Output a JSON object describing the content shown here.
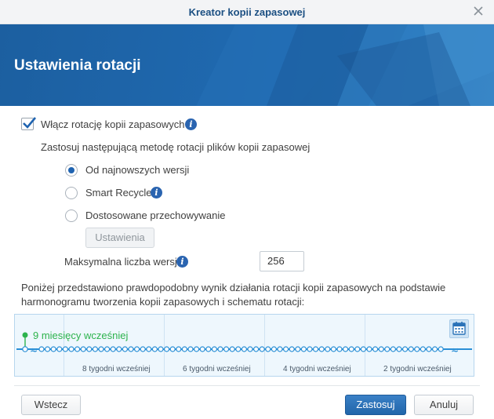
{
  "window": {
    "title": "Kreator kopii zapasowej"
  },
  "banner": {
    "heading": "Ustawienia rotacji"
  },
  "rotation": {
    "enable_label": "Włącz rotację kopii zapasowych",
    "enabled": true,
    "method_label": "Zastosuj następującą metodę rotacji plików kopii zapasowej",
    "options": [
      {
        "label": "Od najnowszych wersji",
        "selected": true
      },
      {
        "label": "Smart Recycle",
        "selected": false
      },
      {
        "label": "Dostosowane przechowywanie",
        "selected": false
      }
    ],
    "settings_button": "Ustawienia",
    "max_versions_label": "Maksymalna liczba wersji",
    "max_versions_value": "256"
  },
  "preview": {
    "description_line1": "Poniżej przedstawiono prawdopodobny wynik działania rotacji kopii zapasowych na podstawie",
    "description_line2": "harmonogramu tworzenia kopii zapasowych i schematu rotacji:",
    "oldest_label": "9 miesięcy wcześniej",
    "tick_labels": [
      "8 tygodni wcześniej",
      "6 tygodni wcześniej",
      "4 tygodni wcześniej",
      "2 tygodni wcześniej"
    ]
  },
  "footer": {
    "back": "Wstecz",
    "apply": "Zastosuj",
    "cancel": "Anuluj"
  },
  "colors": {
    "accent": "#1f63b0",
    "banner": "#1f68ae",
    "timeline_green": "#2db34d",
    "timeline_blue": "#2a8fd6"
  },
  "icons": [
    "close-icon",
    "checkmark-icon",
    "info-icon",
    "calendar-icon"
  ]
}
